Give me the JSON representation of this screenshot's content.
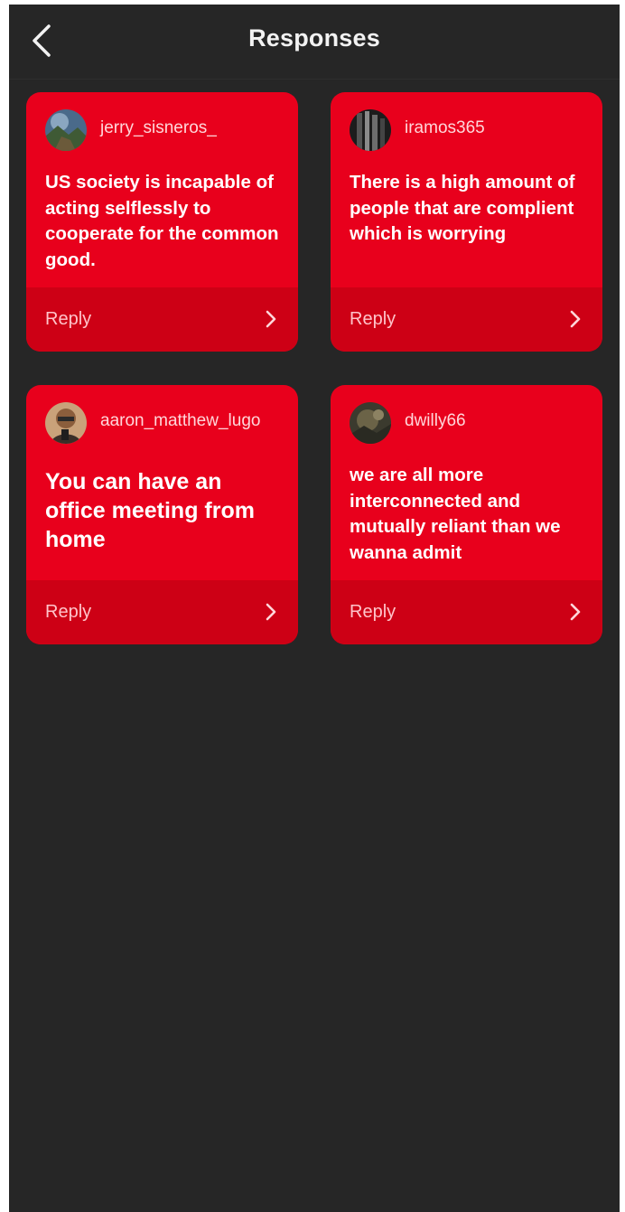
{
  "header": {
    "title": "Responses",
    "back_icon": "chevron-left-icon"
  },
  "colors": {
    "background": "#262626",
    "card": "#e8001c",
    "card_footer": "#cd0015",
    "text": "#ffffff"
  },
  "responses": [
    {
      "username": "jerry_sisneros_",
      "message": "US society is incapable of acting selflessly to cooperate for the common good.",
      "reply_label": "Reply",
      "chevron_icon": "chevron-right-icon"
    },
    {
      "username": "iramos365",
      "message": "There is a high amount of people that are complient which is worrying",
      "reply_label": "Reply",
      "chevron_icon": "chevron-right-icon"
    },
    {
      "username": "aaron_matthew_lugo",
      "message": "You can have an office meeting from home",
      "reply_label": "Reply",
      "chevron_icon": "chevron-right-icon"
    },
    {
      "username": "dwilly66",
      "message": "we are all more interconnected and mutually reliant than we wanna admit",
      "reply_label": "Reply",
      "chevron_icon": "chevron-right-icon"
    }
  ]
}
